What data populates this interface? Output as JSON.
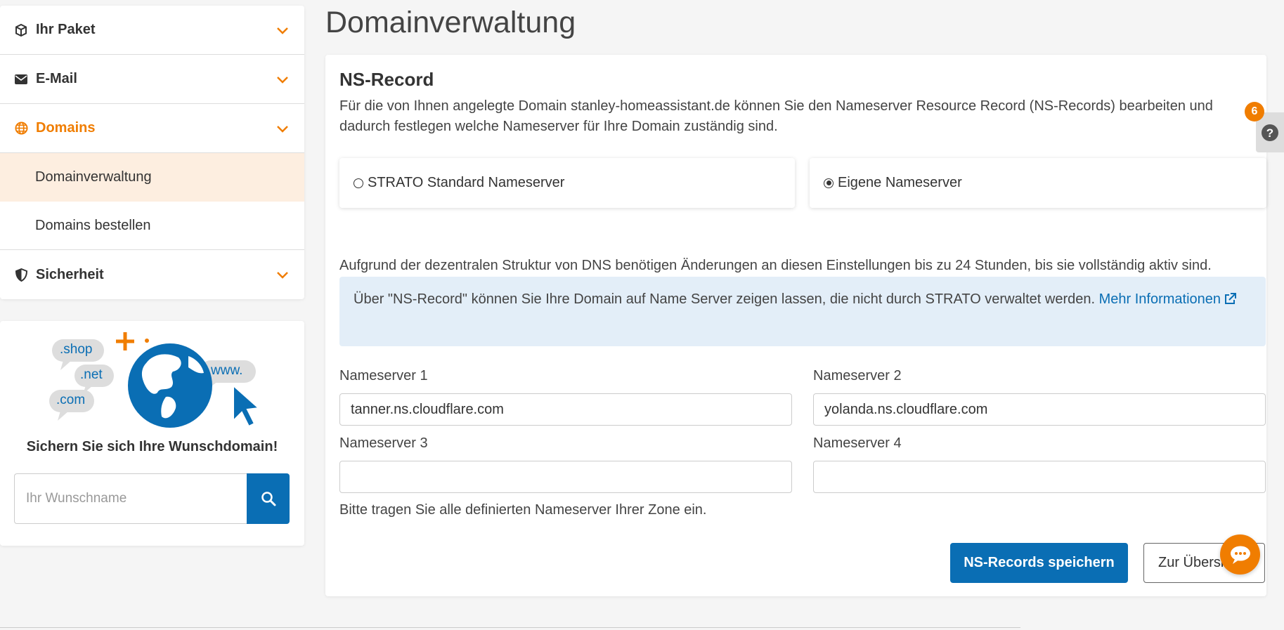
{
  "sidebar": {
    "items": [
      {
        "label": "Ihr Paket",
        "icon": "package-icon"
      },
      {
        "label": "E-Mail",
        "icon": "envelope-icon"
      },
      {
        "label": "Domains",
        "icon": "globe-icon"
      },
      {
        "label": "Sicherheit",
        "icon": "shield-icon"
      }
    ],
    "sub_items": [
      {
        "label": "Domainverwaltung"
      },
      {
        "label": "Domains bestellen"
      }
    ]
  },
  "promo": {
    "bubbles": [
      ".shop",
      ".net",
      ".com",
      "www."
    ],
    "title": "Sichern Sie sich Ihre Wunschdomain!",
    "search_placeholder": "Ihr Wunschname"
  },
  "page": {
    "title": "Domainverwaltung"
  },
  "ns_record": {
    "title": "NS-Record",
    "intro": "Für die von Ihnen angelegte Domain stanley-homeassistant.de können Sie den Nameserver Resource Record (NS-Records) bearbeiten und dadurch festlegen welche Nameserver für Ihre Domain zuständig sind.",
    "options": [
      {
        "label": "STRATO Standard Nameserver",
        "selected": false
      },
      {
        "label": "Eigene Nameserver",
        "selected": true
      }
    ],
    "delay_note": "Aufgrund der dezentralen Struktur von DNS benötigen Änderungen an diesen Einstellungen bis zu 24 Stunden, bis sie vollständig aktiv sind.",
    "info_text": "Über \"NS-Record\" können Sie Ihre Domain auf Name Server zeigen lassen, die nicht durch STRATO verwaltet werden.",
    "info_link": "Mehr Informationen",
    "fields": [
      {
        "label": "Nameserver 1",
        "value": "tanner.ns.cloudflare.com"
      },
      {
        "label": "Nameserver 2",
        "value": "yolanda.ns.cloudflare.com"
      },
      {
        "label": "Nameserver 3",
        "value": ""
      },
      {
        "label": "Nameserver 4",
        "value": ""
      }
    ],
    "hint": "Bitte tragen Sie alle definierten Nameserver Ihrer Zone ein.",
    "save_label": "NS-Records speichern",
    "back_label": "Zur Übersicht"
  },
  "help": {
    "badge": "6",
    "icon": "help-icon"
  },
  "colors": {
    "accent": "#f07d00",
    "primary": "#0a6eb4",
    "info_bg": "#e3eef8",
    "selected_bg": "#fdeee0"
  }
}
